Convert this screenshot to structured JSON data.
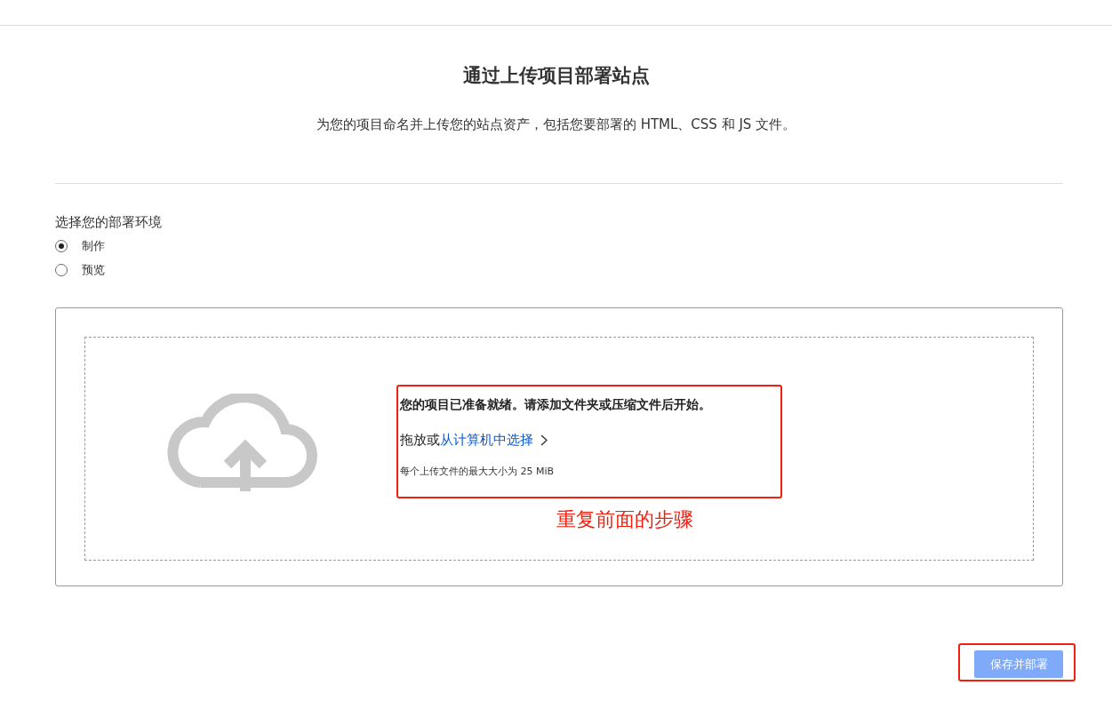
{
  "title": "通过上传项目部署站点",
  "description": "为您的项目命名并上传您的站点资产，包括您要部署的 HTML、CSS 和 JS 文件。",
  "environment": {
    "label": "选择您的部署环境",
    "options": [
      {
        "label": "制作",
        "selected": true
      },
      {
        "label": "预览",
        "selected": false
      }
    ]
  },
  "upload": {
    "heading": "您的项目已准备就绪。请添加文件夹或压缩文件后开始。",
    "drop_text": "拖放或",
    "choose_link": "从计算机中选择",
    "size_note": "每个上传文件的最大大小为 25 MiB"
  },
  "annotation": "重复前面的步骤",
  "save_button": {
    "label": "保存并部署",
    "disabled": true
  }
}
